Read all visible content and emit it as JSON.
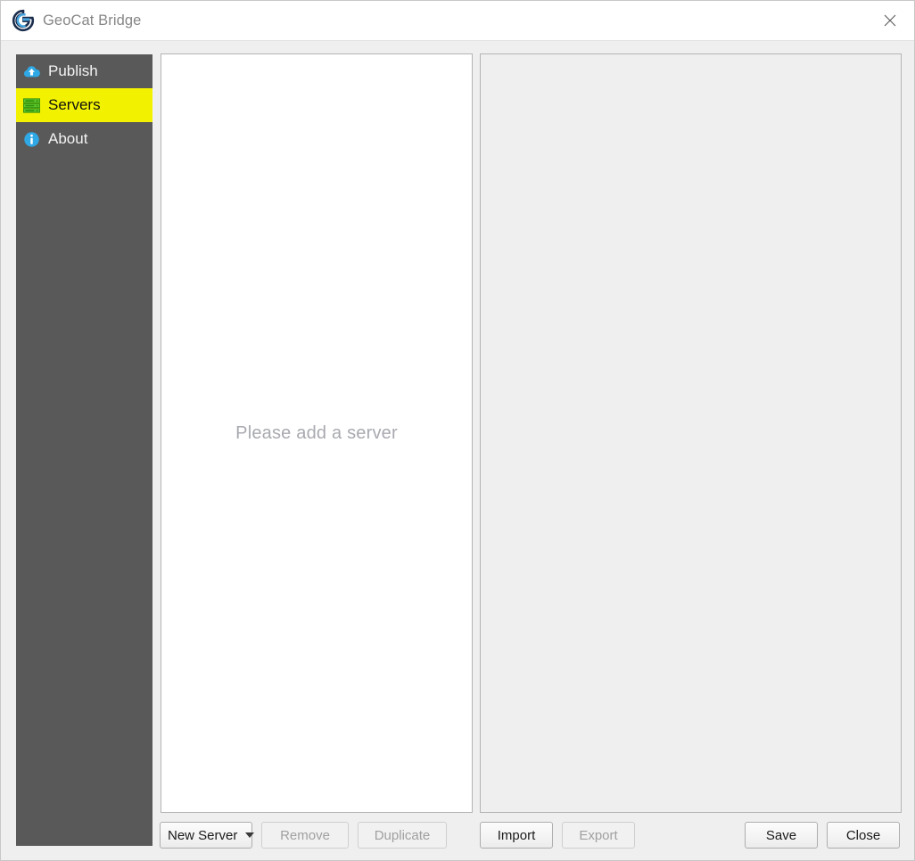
{
  "window": {
    "title": "GeoCat Bridge",
    "logo_icon": "geocat-g-logo",
    "close_icon": "close-icon",
    "background_color": "#efefef",
    "titlebar_color": "#ffffff"
  },
  "sidebar": {
    "background_color": "#595959",
    "selected_color": "#f2f200",
    "items": [
      {
        "label": "Publish",
        "icon": "cloud-upload-icon",
        "selected": false
      },
      {
        "label": "Servers",
        "icon": "server-stack-icon",
        "selected": true
      },
      {
        "label": "About",
        "icon": "info-circle-icon",
        "selected": false
      }
    ]
  },
  "main": {
    "server_list": {
      "empty_message": "Please add a server",
      "empty_message_color": "#a8aab0"
    },
    "detail_panel": {
      "background_color": "#efefef"
    }
  },
  "toolbar": {
    "new_server_label": "New Server",
    "new_server_caret_icon": "chevron-down-icon",
    "remove_label": "Remove",
    "remove_enabled": false,
    "duplicate_label": "Duplicate",
    "duplicate_enabled": false,
    "import_label": "Import",
    "import_enabled": true,
    "export_label": "Export",
    "export_enabled": false,
    "save_label": "Save",
    "close_label": "Close"
  }
}
